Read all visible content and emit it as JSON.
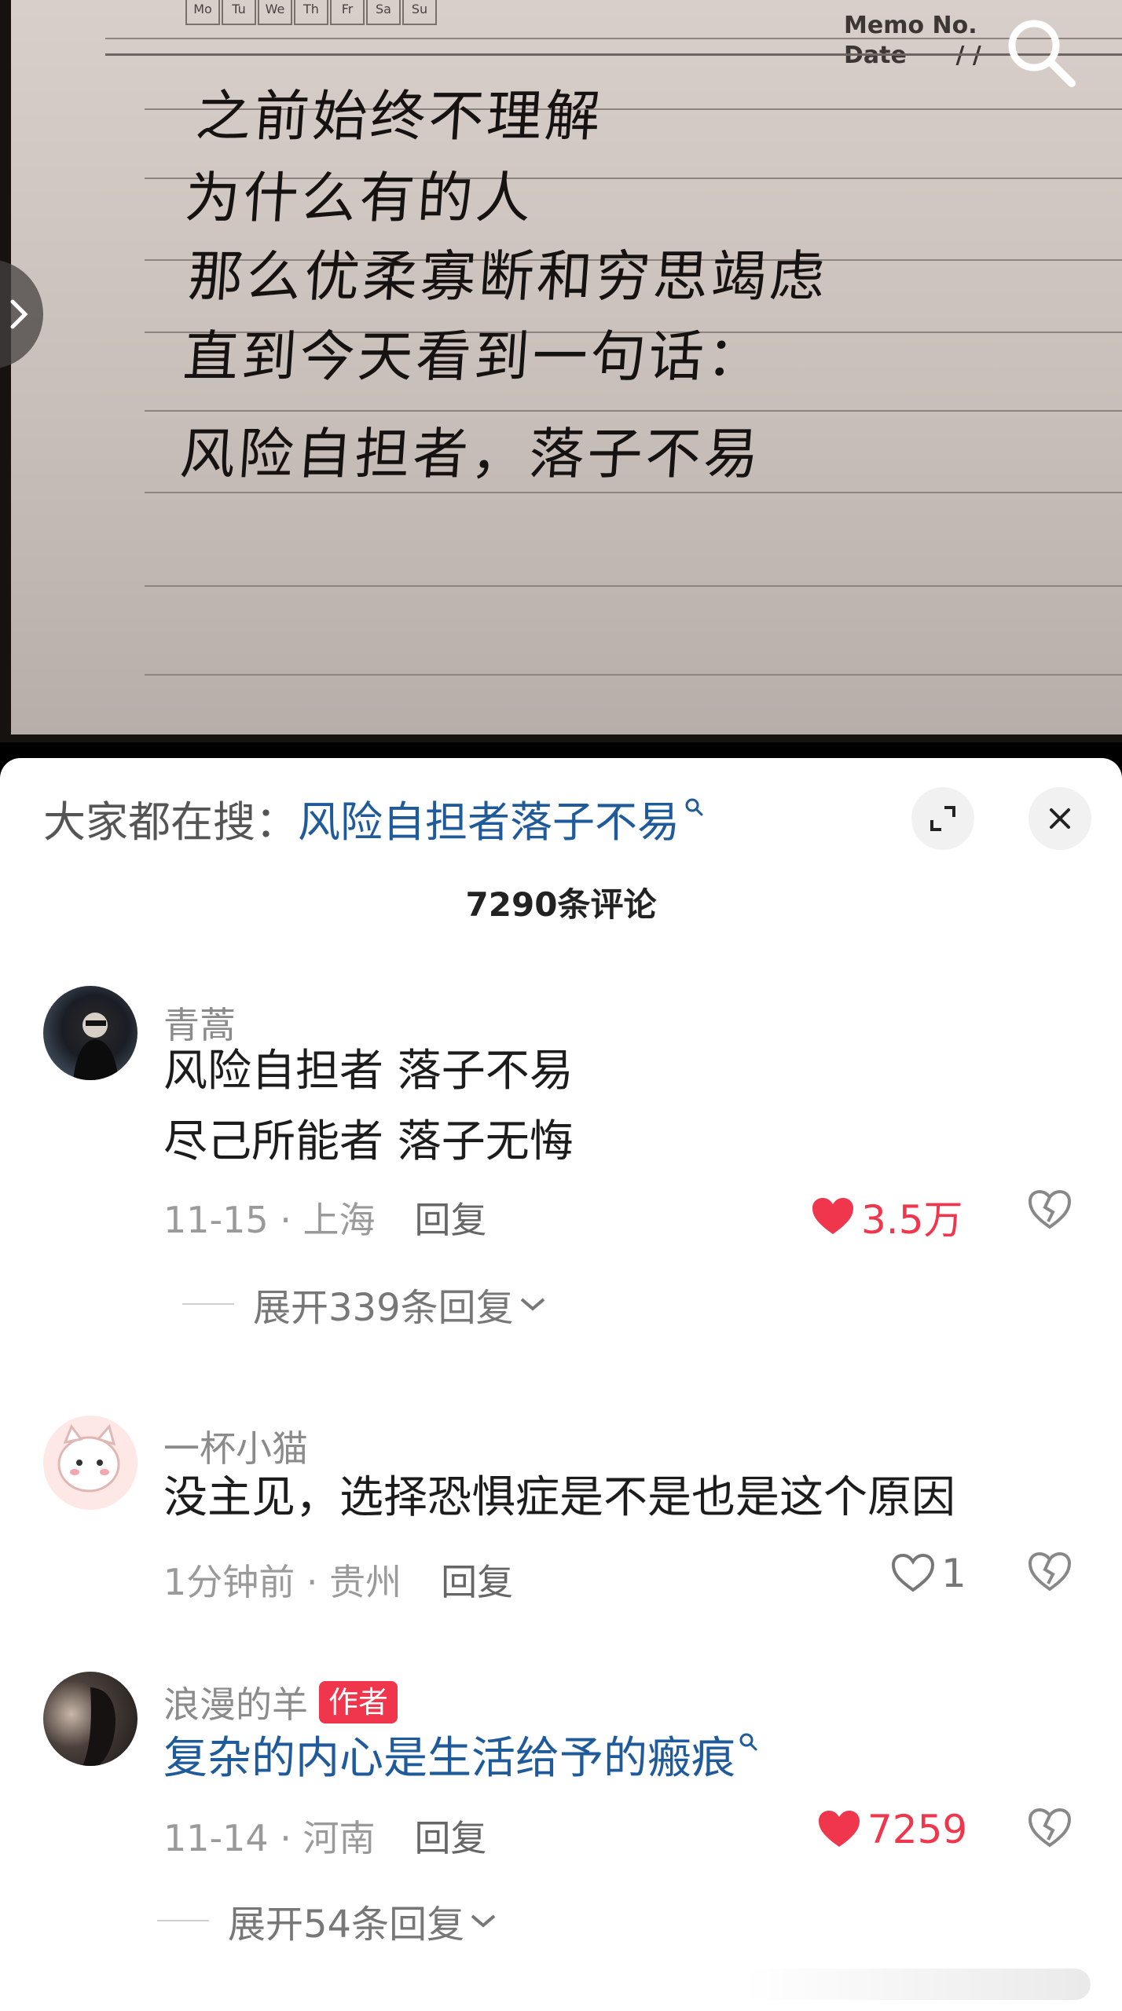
{
  "photo": {
    "weekdays": [
      "Mo",
      "Tu",
      "We",
      "Th",
      "Fr",
      "Sa",
      "Su"
    ],
    "memo_no": "Memo No.",
    "date_label": "Date",
    "date_slashes": "/     /",
    "lines": [
      "之前始终不理解",
      "为什么有的人",
      "那么优柔寡断和穷思竭虑",
      "直到今天看到一句话：",
      "风险自担者，落子不易"
    ]
  },
  "search_bar": {
    "label": "大家都在搜：",
    "query": "风险自担者落子不易"
  },
  "comment_count": "7290条评论",
  "comments": [
    {
      "username": "青蒿",
      "text_lines": [
        "风险自担者 落子不易",
        "尽己所能者 落子无悔"
      ],
      "date_location": "11-15 · 上海",
      "reply": "回复",
      "likes": "3.5万",
      "liked": true,
      "expand": "展开339条回复"
    },
    {
      "username": "一杯小猫",
      "text_lines": [
        "没主见，选择恐惧症是不是也是这个原因"
      ],
      "date_location": "1分钟前 · 贵州",
      "reply": "回复",
      "likes": "1",
      "liked": false
    },
    {
      "username": "浪漫的羊",
      "badge": "作者",
      "text_lines": [
        "复杂的内心是生活给予的瘢痕"
      ],
      "date_location": "11-14 · 河南",
      "reply": "回复",
      "likes": "7259",
      "liked": true,
      "expand": "展开54条回复"
    }
  ],
  "colors": {
    "link_blue": "#1f5a9a",
    "like_red": "#f0364c",
    "author_badge": "#f0364c"
  },
  "icons": [
    "search-icon",
    "expand-icon",
    "close-icon",
    "heart-icon",
    "heart-outline-icon",
    "broken-heart-icon",
    "chevron-down-icon",
    "chevron-right-icon"
  ]
}
